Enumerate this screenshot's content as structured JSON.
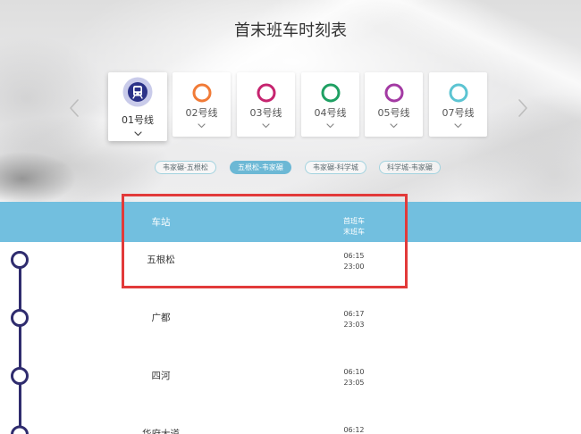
{
  "page": {
    "title": "首末班车时刻表"
  },
  "nav": {
    "prev_icon": "chevron-left-icon",
    "next_icon": "chevron-right-icon"
  },
  "lines": [
    {
      "label": "01号线",
      "color": "#2b3288",
      "icon": "train-icon",
      "selected": true
    },
    {
      "label": "02号线",
      "color": "#f17b37",
      "icon": "line-ring-icon",
      "selected": false
    },
    {
      "label": "03号线",
      "color": "#c6246f",
      "icon": "line-ring-icon",
      "selected": false
    },
    {
      "label": "04号线",
      "color": "#1fa063",
      "icon": "line-ring-icon",
      "selected": false
    },
    {
      "label": "05号线",
      "color": "#a33aa3",
      "icon": "line-ring-icon",
      "selected": false
    },
    {
      "label": "07号线",
      "color": "#5cc4d2",
      "icon": "line-ring-icon",
      "selected": false
    }
  ],
  "directions": [
    {
      "label": "韦家碾-五根松",
      "selected": false
    },
    {
      "label": "五根松-韦家碾",
      "selected": true
    },
    {
      "label": "韦家碾-科学城",
      "selected": false
    },
    {
      "label": "科学城-韦家碾",
      "selected": false
    }
  ],
  "table": {
    "header": {
      "station": "车站",
      "first": "首班车",
      "last": "末班车"
    },
    "rows": [
      {
        "station": "五根松",
        "first": "06:15",
        "last": "23:00"
      },
      {
        "station": "广都",
        "first": "06:17",
        "last": "23:03"
      },
      {
        "station": "四河",
        "first": "06:10",
        "last": "23:05"
      },
      {
        "station": "华府大道",
        "first": "06:12"
      }
    ]
  },
  "theme": {
    "header_band": "#72bfdf",
    "pill_active": "#6cb8d5",
    "pill_border": "#a3d3df",
    "timeline": "#2f2c6e",
    "highlight": "#e23a3a"
  }
}
